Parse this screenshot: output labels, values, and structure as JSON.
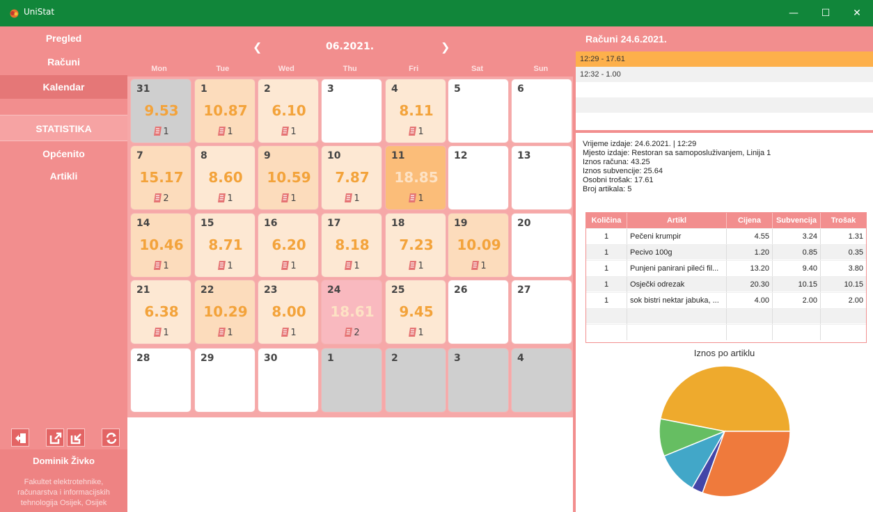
{
  "window": {
    "title": "UniStat",
    "min": "—",
    "max": "☐",
    "close": "✕"
  },
  "sidebar": {
    "nav": [
      "Pregled",
      "Računi",
      "Kalendar"
    ],
    "stats_header": "STATISTIKA",
    "stats": [
      "Općenito",
      "Artikli"
    ],
    "buttons": [
      "logout-icon",
      "export-icon",
      "import-icon",
      "refresh-icon"
    ],
    "user_name": "Dominik Živko",
    "institution": "Fakultet elektrotehnike, računarstva i informacijskih tehnologija Osijek, Osijek"
  },
  "calendar": {
    "month": "06.2021.",
    "prev": "❮",
    "next": "❯",
    "days": [
      "Mon",
      "Tue",
      "Wed",
      "Thu",
      "Fri",
      "Sat",
      "Sun"
    ],
    "weeks": [
      [
        {
          "d": "31",
          "amt": "9.53",
          "cnt": "1",
          "kind": "other"
        },
        {
          "d": "1",
          "amt": "10.87",
          "cnt": "1",
          "kind": "mid"
        },
        {
          "d": "2",
          "amt": "6.10",
          "cnt": "1",
          "kind": "light"
        },
        {
          "d": "3",
          "kind": "empty"
        },
        {
          "d": "4",
          "amt": "8.11",
          "cnt": "1",
          "kind": "light"
        },
        {
          "d": "5",
          "kind": "empty"
        },
        {
          "d": "6",
          "kind": "empty"
        }
      ],
      [
        {
          "d": "7",
          "amt": "15.17",
          "cnt": "2",
          "kind": "mid"
        },
        {
          "d": "8",
          "amt": "8.60",
          "cnt": "1",
          "kind": "light"
        },
        {
          "d": "9",
          "amt": "10.59",
          "cnt": "1",
          "kind": "mid"
        },
        {
          "d": "10",
          "amt": "7.87",
          "cnt": "1",
          "kind": "light"
        },
        {
          "d": "11",
          "amt": "18.85",
          "cnt": "1",
          "kind": "dark"
        },
        {
          "d": "12",
          "kind": "empty"
        },
        {
          "d": "13",
          "kind": "empty"
        }
      ],
      [
        {
          "d": "14",
          "amt": "10.46",
          "cnt": "1",
          "kind": "mid"
        },
        {
          "d": "15",
          "amt": "8.71",
          "cnt": "1",
          "kind": "light"
        },
        {
          "d": "16",
          "amt": "6.20",
          "cnt": "1",
          "kind": "light"
        },
        {
          "d": "17",
          "amt": "8.18",
          "cnt": "1",
          "kind": "light"
        },
        {
          "d": "18",
          "amt": "7.23",
          "cnt": "1",
          "kind": "light"
        },
        {
          "d": "19",
          "amt": "10.09",
          "cnt": "1",
          "kind": "mid"
        },
        {
          "d": "20",
          "kind": "empty"
        }
      ],
      [
        {
          "d": "21",
          "amt": "6.38",
          "cnt": "1",
          "kind": "light"
        },
        {
          "d": "22",
          "amt": "10.29",
          "cnt": "1",
          "kind": "mid"
        },
        {
          "d": "23",
          "amt": "8.00",
          "cnt": "1",
          "kind": "light"
        },
        {
          "d": "24",
          "amt": "18.61",
          "cnt": "2",
          "kind": "selected"
        },
        {
          "d": "25",
          "amt": "9.45",
          "cnt": "1",
          "kind": "light"
        },
        {
          "d": "26",
          "kind": "empty"
        },
        {
          "d": "27",
          "kind": "empty"
        }
      ],
      [
        {
          "d": "28",
          "kind": "empty"
        },
        {
          "d": "29",
          "kind": "empty"
        },
        {
          "d": "30",
          "kind": "empty"
        },
        {
          "d": "1",
          "kind": "other"
        },
        {
          "d": "2",
          "kind": "other"
        },
        {
          "d": "3",
          "kind": "other"
        },
        {
          "d": "4",
          "kind": "other"
        }
      ]
    ],
    "colors": {
      "empty": "#ffffff",
      "other": "#cfcfcf",
      "light": "#fde8d3",
      "mid": "#fcdcbc",
      "dark": "#fbbd79",
      "selected": "#f9b9bf"
    }
  },
  "receipts": {
    "title": "Računi  24.6.2021.",
    "list": [
      "12:29 - 17.61",
      "12:32 - 1.00"
    ],
    "details": [
      "Vrijeme izdaje: 24.6.2021. | 12:29",
      "Mjesto izdaje: Restoran sa samoposluživanjem, Linija 1",
      "Iznos računa: 43.25",
      "Iznos subvencije: 25.64",
      "Osobni trošak: 17.61",
      "Broj artikala: 5"
    ],
    "table": {
      "headers": [
        "Količina",
        "Artikl",
        "Cijena",
        "Subvencija",
        "Trošak"
      ],
      "rows": [
        [
          "1",
          "Pečeni krumpir",
          "4.55",
          "3.24",
          "1.31"
        ],
        [
          "1",
          "Pecivo 100g",
          "1.20",
          "0.85",
          "0.35"
        ],
        [
          "1",
          "Punjeni panirani pileći fil...",
          "13.20",
          "9.40",
          "3.80"
        ],
        [
          "1",
          "Osječki odrezak",
          "20.30",
          "10.15",
          "10.15"
        ],
        [
          "1",
          "sok bistri nektar jabuka, ...",
          "4.00",
          "2.00",
          "2.00"
        ]
      ]
    }
  },
  "chart_data": {
    "type": "pie",
    "title": "Iznos po artiklu",
    "categories": [
      "Pečeni krumpir",
      "Pecivo 100g",
      "Punjeni panirani pileći fil...",
      "Osječki odrezak",
      "sok bistri nektar jabuka, ..."
    ],
    "values": [
      4.55,
      1.2,
      13.2,
      20.3,
      4.0
    ],
    "colors": [
      "#42a7c8",
      "#4346a8",
      "#ef7a3c",
      "#eeaa2d",
      "#66be62"
    ],
    "order": [
      3,
      4,
      0,
      1,
      2
    ]
  }
}
